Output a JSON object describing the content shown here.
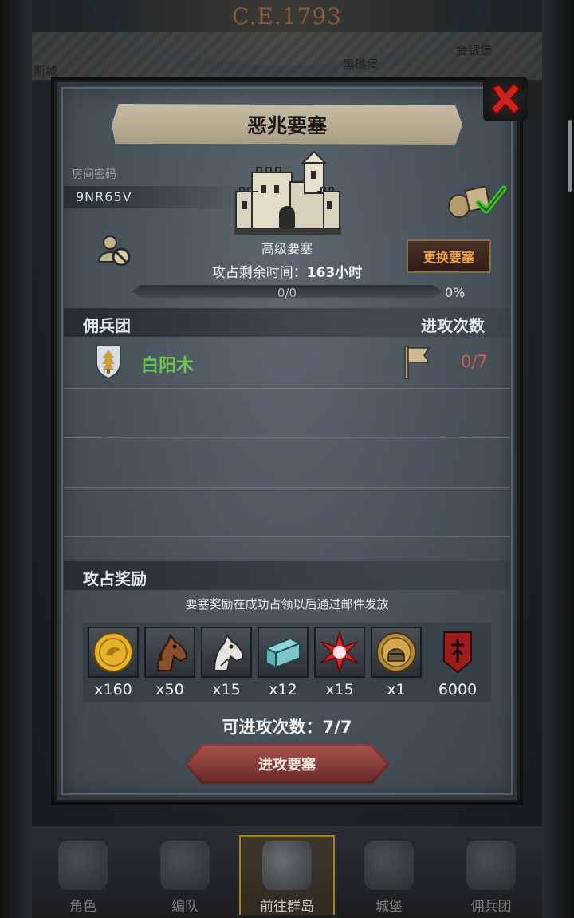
{
  "background": {
    "year": "C.E.1793",
    "map_labels": [
      "斯城",
      "黑礁堡",
      "金银堡"
    ]
  },
  "bottom_nav": [
    {
      "label": "角色",
      "icon": "character-icon",
      "active": false
    },
    {
      "label": "编队",
      "icon": "formation-icon",
      "active": false
    },
    {
      "label": "前往群岛",
      "icon": "islands-icon",
      "active": true
    },
    {
      "label": "城堡",
      "icon": "castle-icon",
      "active": false
    },
    {
      "label": "佣兵团",
      "icon": "mercenary-icon",
      "active": false
    }
  ],
  "panel": {
    "title": "恶兆要塞",
    "room_label": "房间密码",
    "room_code": "9NR65V",
    "castle_name": "高级要塞",
    "change_button": "更换要塞",
    "time_left_label": "攻占剩余时间：",
    "time_left_value": "163小时",
    "progress_text": "0/0",
    "progress_percent": "0%",
    "progress_value": 0,
    "mercenary_header": "佣兵团",
    "attacks_header": "进攻次数",
    "mercenary": {
      "name": "白阳木",
      "attacks": "0/7",
      "emblem": "tree-shield-icon"
    },
    "reward_header": "攻占奖励",
    "reward_note": "要塞奖励在成功占领以后通过邮件发放",
    "rewards": [
      {
        "icon": "gold-coin-icon",
        "qty": "x160"
      },
      {
        "icon": "brown-horse-icon",
        "qty": "x50"
      },
      {
        "icon": "white-horse-icon",
        "qty": "x15"
      },
      {
        "icon": "cloth-scroll-icon",
        "qty": "x12"
      },
      {
        "icon": "red-star-icon",
        "qty": "x15"
      },
      {
        "icon": "knight-medal-icon",
        "qty": "x1"
      },
      {
        "icon": "red-banner-icon",
        "qty": "6000"
      }
    ],
    "attacks_remaining_label": "可进攻次数：",
    "attacks_remaining_value": "7/7",
    "attack_button": "进攻要塞"
  },
  "colors": {
    "merc_name": "#6ec452",
    "attack_count": "#d25a4d",
    "change_button_text": "#f2a24a",
    "attack_button": "#8c3b38"
  }
}
